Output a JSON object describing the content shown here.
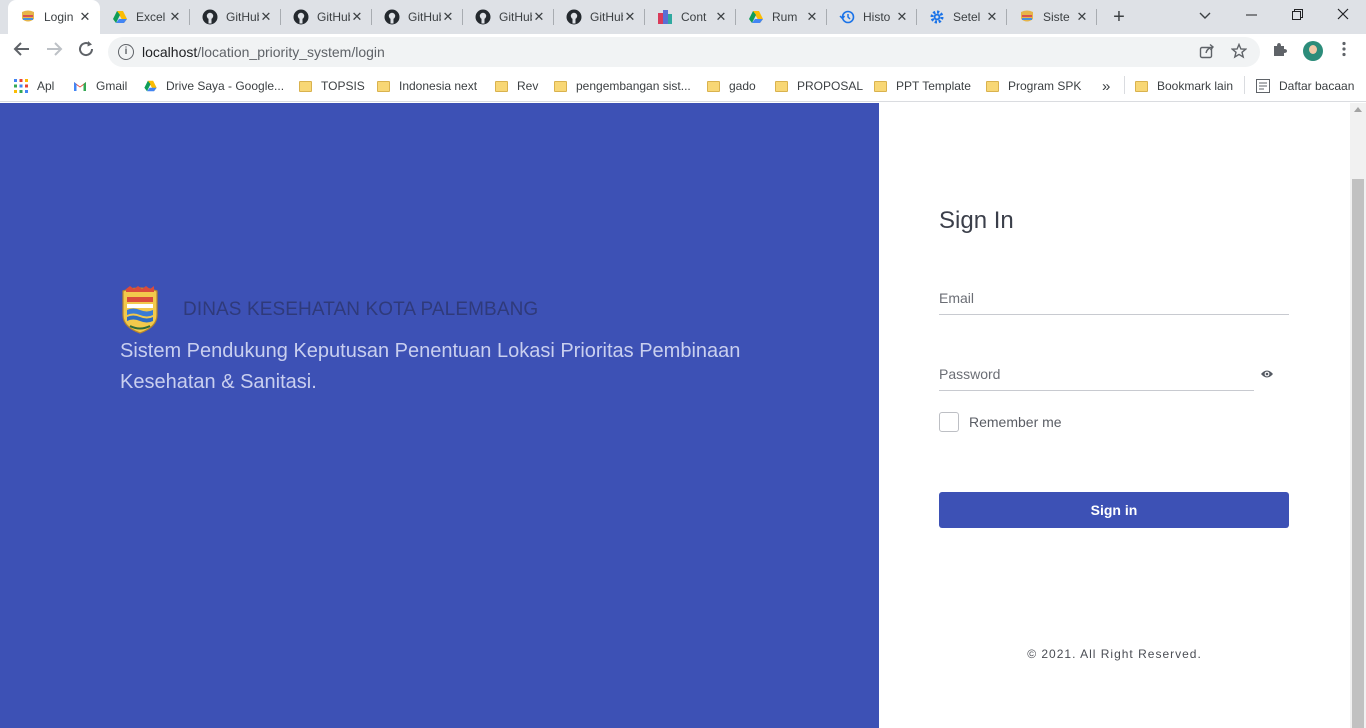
{
  "browser": {
    "tabs": [
      {
        "title": "Login",
        "icon": "app-logo-icon",
        "active": true
      },
      {
        "title": "Excel",
        "icon": "google-drive-icon"
      },
      {
        "title": "GitHub",
        "icon": "github-icon"
      },
      {
        "title": "GitHub",
        "icon": "github-icon"
      },
      {
        "title": "GitHub",
        "icon": "github-icon"
      },
      {
        "title": "GitHub",
        "icon": "github-icon"
      },
      {
        "title": "GitHub",
        "icon": "github-icon"
      },
      {
        "title": "Cont",
        "icon": "building-icon"
      },
      {
        "title": "Rum",
        "icon": "google-drive-icon"
      },
      {
        "title": "Histo",
        "icon": "history-icon"
      },
      {
        "title": "Setel",
        "icon": "gear-icon"
      },
      {
        "title": "Siste",
        "icon": "app-logo-icon"
      }
    ],
    "close_glyph": "✕",
    "new_tab_glyph": "+",
    "url_host": "localhost",
    "url_path": "/location_priority_system/login",
    "bookmarks": [
      {
        "label": "Apl",
        "icon": "apps-grid-icon"
      },
      {
        "label": "Gmail",
        "icon": "gmail-icon"
      },
      {
        "label": "Drive Saya - Google...",
        "icon": "google-drive-icon"
      },
      {
        "label": "TOPSIS",
        "icon": "folder-icon"
      },
      {
        "label": "Indonesia next",
        "icon": "folder-icon"
      },
      {
        "label": "Rev",
        "icon": "folder-icon"
      },
      {
        "label": "pengembangan sist...",
        "icon": "folder-icon"
      },
      {
        "label": "gado",
        "icon": "folder-icon"
      },
      {
        "label": "PROPOSAL",
        "icon": "folder-icon"
      },
      {
        "label": "PPT Template",
        "icon": "folder-icon"
      },
      {
        "label": "Program SPK",
        "icon": "folder-icon"
      }
    ],
    "overflow_glyph": "»",
    "other_bookmarks": "Bookmark lain",
    "reading_list": "Daftar bacaan"
  },
  "hero": {
    "org_name": "DINAS KESEHATAN KOTA PALEMBANG",
    "tagline": "Sistem Pendukung Keputusan Penentuan Lokasi Prioritas Pembinaan Kesehatan & Sanitasi."
  },
  "login": {
    "title": "Sign In",
    "email_label": "Email",
    "password_label": "Password",
    "remember_label": "Remember me",
    "submit_label": "Sign in",
    "copyright": "© 2021. All Right Reserved."
  },
  "colors": {
    "brand": "#3d51b5",
    "tab_bar": "#dee1e6"
  }
}
